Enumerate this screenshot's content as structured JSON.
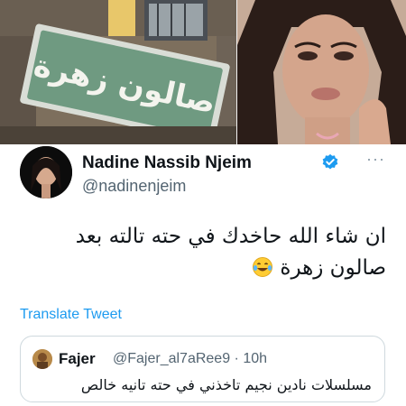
{
  "sign_image": {
    "sign_text": "صالون زهرة"
  },
  "tweet": {
    "author": {
      "name": "Nadine Nassib Njeim",
      "handle": "@nadinenjeim",
      "verified": true
    },
    "text": "ان شاء الله حاخدك في حته تالته بعد صالون زهرة",
    "emoji": "laughing-tears-emoji",
    "translate_label": "Translate Tweet",
    "more_icon": "more-icon"
  },
  "quoted_tweet": {
    "name": "Fajer",
    "handle_time": "@Fajer_al7aRee9 · 10h",
    "text": "مسلسلات نادين نجيم تاخذني في حته تانيه خالص"
  },
  "colors": {
    "accent": "#1d9bf0",
    "text": "#0f1419",
    "secondary": "#536471",
    "border": "#cfd9de",
    "sign_green": "#6f9a81"
  }
}
